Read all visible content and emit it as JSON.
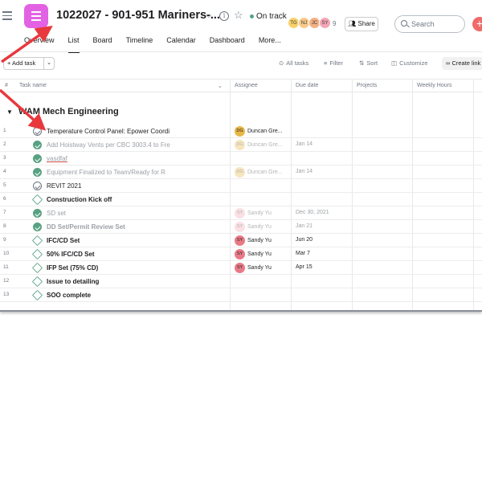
{
  "header": {
    "project_title": "1022027 - 901-951 Mariners-...",
    "status": "On track",
    "members": [
      {
        "initials": "TG",
        "color": "#f8d16c"
      },
      {
        "initials": "NJ",
        "color": "#f8c98a"
      },
      {
        "initials": "JC",
        "color": "#f4b183"
      },
      {
        "initials": "SY",
        "color": "#f3a6b6"
      }
    ],
    "member_count": "9",
    "share_label": "Share",
    "search_placeholder": "Search",
    "add_label": "+"
  },
  "tabs": [
    "Overview",
    "List",
    "Board",
    "Timeline",
    "Calendar",
    "Dashboard",
    "More..."
  ],
  "active_tab": "List",
  "toolbar": {
    "add_task_label": "+ Add task",
    "all_tasks": "All tasks",
    "filter": "Filter",
    "sort": "Sort",
    "customize": "Customize",
    "create_link": "Create link"
  },
  "columns": {
    "num": "#",
    "task_name": "Task name",
    "assignee": "Assignee",
    "due_date": "Due date",
    "projects": "Projects",
    "weekly_hours": "Weekly Hours"
  },
  "section": {
    "title": "WAM Mech Engineering"
  },
  "rows": [
    {
      "num": "1",
      "name": "Temperature Control Panel: Epower Coordi",
      "state": "open",
      "style": "normal",
      "assignee": "Duncan Gre...",
      "initials": "DG",
      "avatar_color": "#e8b74a",
      "assignee_dim": false,
      "due": ""
    },
    {
      "num": "2",
      "name": "Add Hoistway Vents per CBC 3003.4 to Fre",
      "state": "done",
      "style": "dim",
      "assignee": "Duncan Gre...",
      "initials": "DG",
      "avatar_color": "#e8b74a",
      "assignee_dim": true,
      "due": "Jan 14"
    },
    {
      "num": "3",
      "name": "vasdfaf",
      "state": "done",
      "style": "dim-under",
      "assignee": "",
      "initials": "",
      "avatar_color": "",
      "assignee_dim": false,
      "due": ""
    },
    {
      "num": "4",
      "name": "Equipment Finalized to Team/Ready for R",
      "state": "done",
      "style": "dim",
      "assignee": "Duncan Gre...",
      "initials": "DG",
      "avatar_color": "#e8b74a",
      "assignee_dim": true,
      "due": "Jan 14"
    },
    {
      "num": "5",
      "name": "REVIT 2021",
      "state": "open",
      "style": "normal",
      "assignee": "",
      "initials": "",
      "avatar_color": "",
      "assignee_dim": false,
      "due": ""
    },
    {
      "num": "6",
      "name": "Construction Kick off",
      "state": "milestone",
      "style": "bold",
      "assignee": "",
      "initials": "",
      "avatar_color": "",
      "assignee_dim": false,
      "due": ""
    },
    {
      "num": "7",
      "name": "SD set",
      "state": "done",
      "style": "dim",
      "assignee": "Sandy Yu",
      "initials": "SY",
      "avatar_color": "#f3a6b6",
      "assignee_dim": true,
      "due": "Dec 30, 2021"
    },
    {
      "num": "8",
      "name": "DD Set/Permit Review Set",
      "state": "done",
      "style": "dim-bold",
      "assignee": "Sandy Yu",
      "initials": "SY",
      "avatar_color": "#f3a6b6",
      "assignee_dim": true,
      "due": "Jan 21"
    },
    {
      "num": "9",
      "name": "IFC/CD Set",
      "state": "milestone",
      "style": "bold",
      "assignee": "Sandy Yu",
      "initials": "SY",
      "avatar_color": "#e87a86",
      "assignee_dim": false,
      "due": "Jun 20"
    },
    {
      "num": "10",
      "name": "50% IFC/CD Set",
      "state": "milestone",
      "style": "bold",
      "assignee": "Sandy Yu",
      "initials": "SY",
      "avatar_color": "#e87a86",
      "assignee_dim": false,
      "due": "Mar 7"
    },
    {
      "num": "11",
      "name": "IFP Set (75% CD)",
      "state": "milestone",
      "style": "bold",
      "assignee": "Sandy Yu",
      "initials": "SY",
      "avatar_color": "#e87a86",
      "assignee_dim": false,
      "due": "Apr 15"
    },
    {
      "num": "12",
      "name": "Issue to detailing",
      "state": "milestone",
      "style": "bold",
      "assignee": "",
      "initials": "",
      "avatar_color": "",
      "assignee_dim": false,
      "due": ""
    },
    {
      "num": "13",
      "name": "SOO complete",
      "state": "milestone",
      "style": "bold",
      "assignee": "",
      "initials": "",
      "avatar_color": "",
      "assignee_dim": false,
      "due": ""
    }
  ],
  "colors": {
    "accent": "#e362e3",
    "arrow": "#e8383d",
    "complete": "#58a182",
    "add_button": "#f06a6a"
  }
}
